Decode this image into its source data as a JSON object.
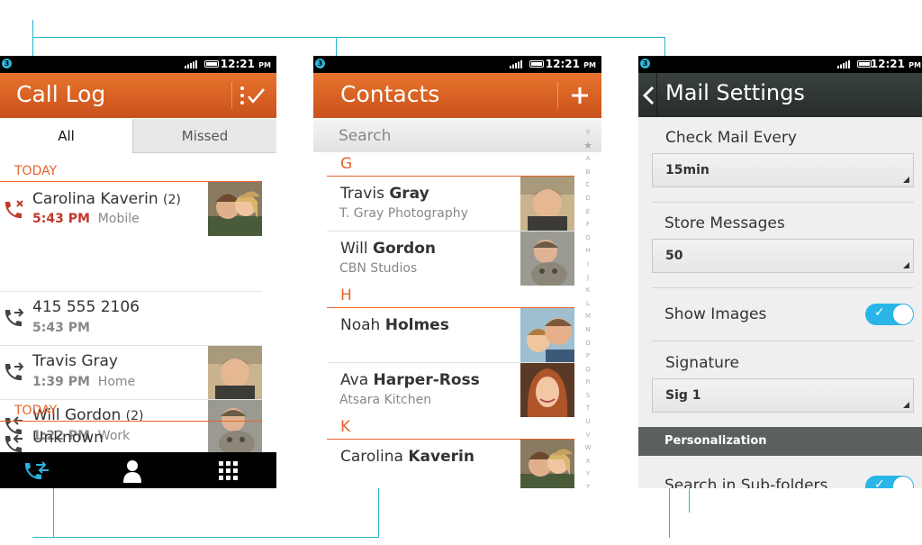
{
  "status": {
    "time": "12:21",
    "ampm": "PM",
    "notification": "3"
  },
  "call_log": {
    "title": "Call Log",
    "tabs": [
      "All",
      "Missed"
    ],
    "sections": [
      "TODAY",
      "TODAY"
    ],
    "entries": [
      {
        "name": "Carolina Kaverin",
        "count": "(2)",
        "time": "5:43 PM",
        "type": "Mobile",
        "missed": true
      },
      {
        "name": "415 555 2106",
        "count": "",
        "time": "5:43 PM",
        "type": "",
        "missed": false
      },
      {
        "name": "Travis Gray",
        "count": "",
        "time": "1:39 PM",
        "type": "Home",
        "missed": false
      },
      {
        "name": "Will Gordon",
        "count": "(2)",
        "time": "1:22 PM",
        "type": "Work",
        "missed": false
      },
      {
        "name": "Unknown",
        "count": "",
        "time": "",
        "type": "",
        "missed": false
      }
    ]
  },
  "contacts": {
    "title": "Contacts",
    "search_placeholder": "Search",
    "groups": [
      {
        "letter": "G",
        "items": [
          {
            "first": "Travis",
            "last": "Gray",
            "org": "T. Gray Photography"
          },
          {
            "first": "Will",
            "last": "Gordon",
            "org": "CBN Studios"
          }
        ]
      },
      {
        "letter": "H",
        "items": [
          {
            "first": "Noah",
            "last": "Holmes",
            "org": ""
          },
          {
            "first": "Ava",
            "last": "Harper-Ross",
            "org": "Atsara Kitchen"
          }
        ]
      },
      {
        "letter": "K",
        "items": [
          {
            "first": "Carolina",
            "last": "Kaverin",
            "org": ""
          }
        ]
      }
    ],
    "alphabet": [
      "A",
      "B",
      "C",
      "D",
      "E",
      "F",
      "G",
      "H",
      "I",
      "J",
      "K",
      "L",
      "M",
      "N",
      "O",
      "P",
      "Q",
      "R",
      "S",
      "T",
      "U",
      "V",
      "W",
      "X",
      "Y",
      "Z"
    ]
  },
  "mail_settings": {
    "title": "Mail Settings",
    "check_mail_label": "Check Mail Every",
    "check_mail_value": "15min",
    "store_messages_label": "Store Messages",
    "store_messages_value": "50",
    "show_images_label": "Show Images",
    "show_images_on": true,
    "signature_label": "Signature",
    "signature_value": "Sig 1",
    "section_header": "Personalization",
    "search_subfolders_label": "Search in Sub-folders",
    "search_subfolders_on": true
  },
  "colors": {
    "accent": "#e7632a",
    "header": "#d35e22",
    "toggle": "#29b5e8",
    "guide": "#29b5cf"
  }
}
